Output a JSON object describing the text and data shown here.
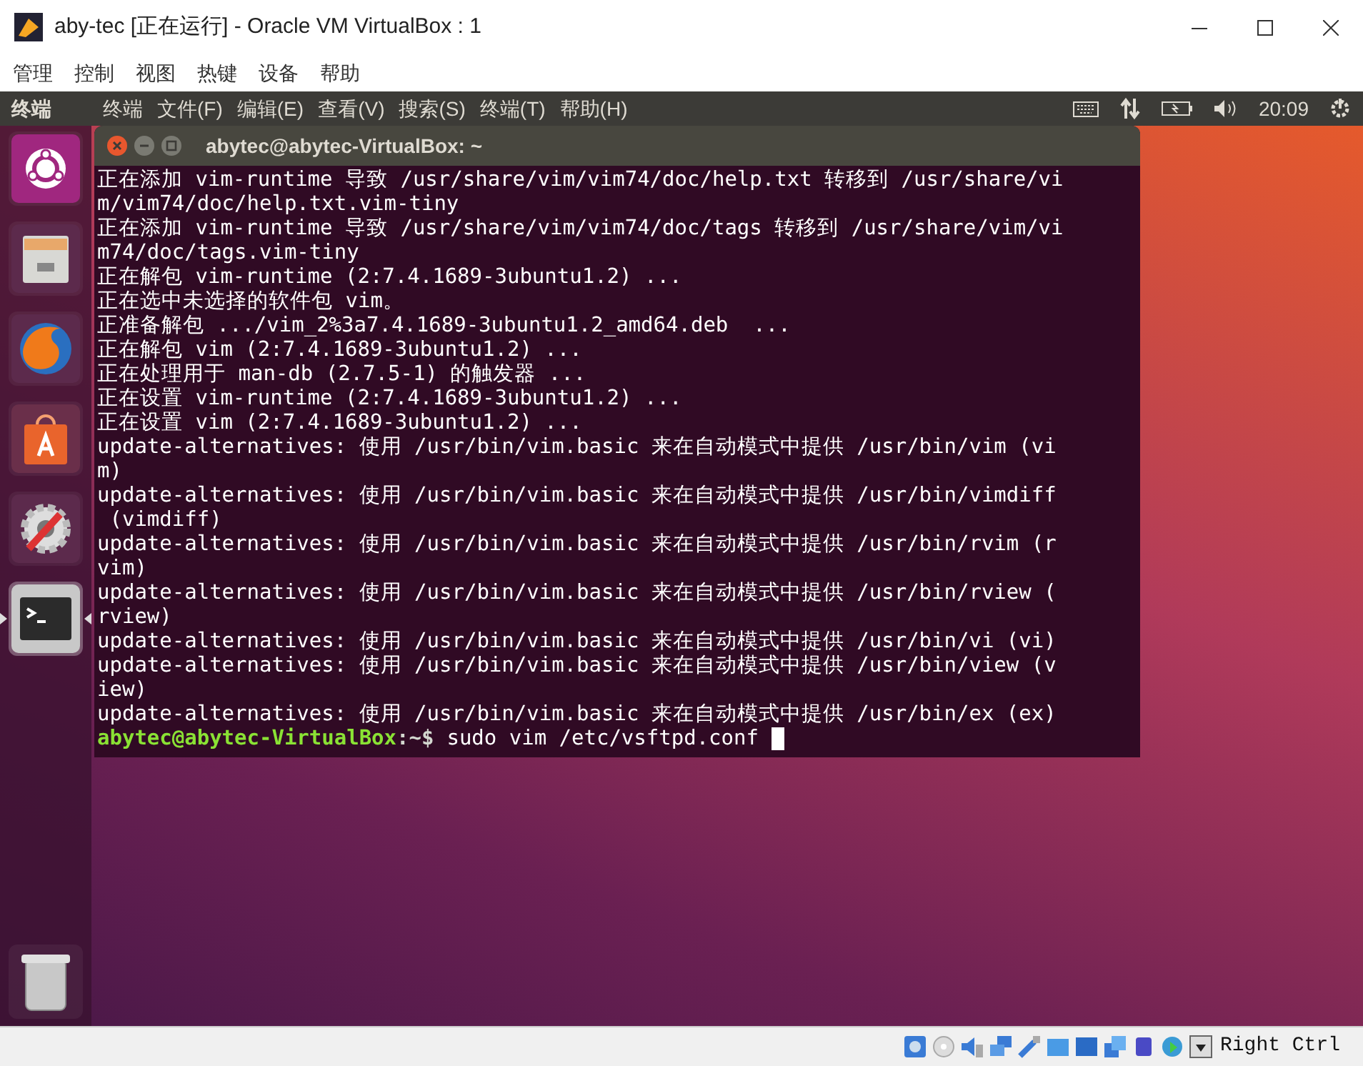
{
  "host_window": {
    "title": "aby-tec [正在运行] - Oracle VM VirtualBox : 1"
  },
  "host_menu": [
    "管理",
    "控制",
    "视图",
    "热键",
    "设备",
    "帮助"
  ],
  "top_bar": {
    "app_name": "终端",
    "menu": [
      "终端",
      "文件(F)",
      "编辑(E)",
      "查看(V)",
      "搜索(S)",
      "终端(T)",
      "帮助(H)"
    ],
    "clock": "20:09"
  },
  "launcher": [
    {
      "kind": "dash",
      "selected": false
    },
    {
      "kind": "files",
      "selected": false
    },
    {
      "kind": "browser",
      "selected": false
    },
    {
      "kind": "store",
      "selected": false
    },
    {
      "kind": "settings",
      "selected": false
    },
    {
      "kind": "terminal",
      "selected": true
    }
  ],
  "terminal": {
    "title": "abytec@abytec-VirtualBox: ~",
    "lines": [
      "正在添加 vim-runtime 导致 /usr/share/vim/vim74/doc/help.txt 转移到 /usr/share/vi",
      "m/vim74/doc/help.txt.vim-tiny",
      "正在添加 vim-runtime 导致 /usr/share/vim/vim74/doc/tags 转移到 /usr/share/vim/vi",
      "m74/doc/tags.vim-tiny",
      "正在解包 vim-runtime (2:7.4.1689-3ubuntu1.2) ...",
      "正在选中未选择的软件包 vim。",
      "正准备解包 .../vim_2%3a7.4.1689-3ubuntu1.2_amd64.deb  ...",
      "正在解包 vim (2:7.4.1689-3ubuntu1.2) ...",
      "正在处理用于 man-db (2.7.5-1) 的触发器 ...",
      "正在设置 vim-runtime (2:7.4.1689-3ubuntu1.2) ...",
      "正在设置 vim (2:7.4.1689-3ubuntu1.2) ...",
      "update-alternatives: 使用 /usr/bin/vim.basic 来在自动模式中提供 /usr/bin/vim (vi",
      "m)",
      "update-alternatives: 使用 /usr/bin/vim.basic 来在自动模式中提供 /usr/bin/vimdiff",
      " (vimdiff)",
      "update-alternatives: 使用 /usr/bin/vim.basic 来在自动模式中提供 /usr/bin/rvim (r",
      "vim)",
      "update-alternatives: 使用 /usr/bin/vim.basic 来在自动模式中提供 /usr/bin/rview (",
      "rview)",
      "update-alternatives: 使用 /usr/bin/vim.basic 来在自动模式中提供 /usr/bin/vi (vi)",
      "update-alternatives: 使用 /usr/bin/vim.basic 来在自动模式中提供 /usr/bin/view (v",
      "iew)",
      "update-alternatives: 使用 /usr/bin/vim.basic 来在自动模式中提供 /usr/bin/ex (ex)"
    ],
    "prompt": {
      "user_host": "abytec@abytec-VirtualBox",
      "path": ":~$",
      "command": "sudo vim /etc/vsftpd.conf"
    }
  },
  "status_bar": {
    "host_key": "Right Ctrl"
  }
}
